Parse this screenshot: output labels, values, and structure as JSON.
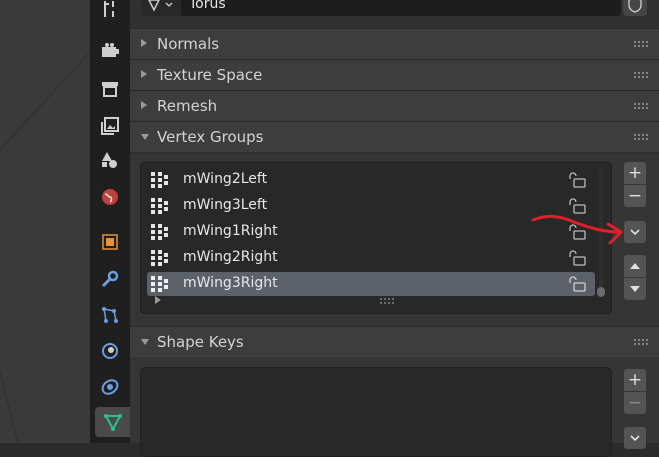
{
  "object_data": {
    "name_value": "Torus"
  },
  "sections": {
    "normals": "Normals",
    "texture_space": "Texture Space",
    "remesh": "Remesh",
    "vertex_groups": "Vertex Groups",
    "shape_keys": "Shape Keys"
  },
  "vertex_groups": {
    "items": [
      {
        "name": "mWing2Left"
      },
      {
        "name": "mWing3Left"
      },
      {
        "name": "mWing1Right"
      },
      {
        "name": "mWing2Right"
      },
      {
        "name": "mWing3Right"
      }
    ],
    "selected_index": 4,
    "add_label": "+",
    "remove_label": "−"
  },
  "shape_keys": {
    "add_label": "+",
    "remove_label": "−"
  },
  "tabs": [
    "tool-icon",
    "render-icon",
    "output-icon",
    "view-layer-icon",
    "scene-icon",
    "world-icon",
    "object-icon",
    "modifier-icon",
    "particles-icon",
    "physics-icon",
    "constraints-icon",
    "data-icon"
  ],
  "colors": {
    "annotation_red": "#e0202a",
    "active_tab_icon": "#2fbf8f",
    "selection": "#5c6169"
  }
}
